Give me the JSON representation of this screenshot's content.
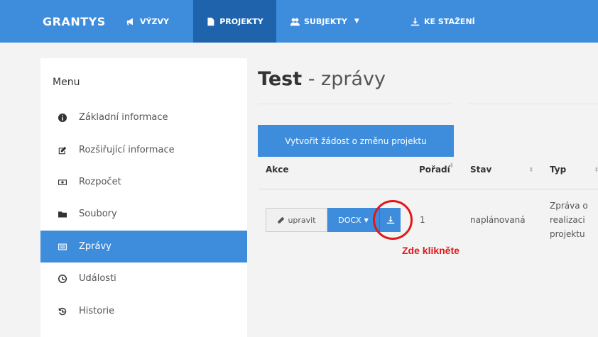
{
  "navbar": {
    "brand": "GRANTYS",
    "items": [
      {
        "label": "VÝZVY",
        "icon": "bullhorn-icon"
      },
      {
        "label": "PROJEKTY",
        "icon": "file-icon",
        "active": true
      },
      {
        "label": "SUBJEKTY",
        "icon": "users-icon",
        "dropdown": true
      },
      {
        "label": "KE STAŽENÍ",
        "icon": "download-icon"
      }
    ]
  },
  "sidebar": {
    "title": "Menu",
    "items": [
      {
        "label": "Základní informace",
        "icon": "info-icon"
      },
      {
        "label": "Rozšiřující informace",
        "icon": "edit-icon"
      },
      {
        "label": "Rozpočet",
        "icon": "money-icon"
      },
      {
        "label": "Soubory",
        "icon": "folder-icon"
      },
      {
        "label": "Zprávy",
        "icon": "list-icon",
        "active": true
      },
      {
        "label": "Události",
        "icon": "clock-icon"
      },
      {
        "label": "Historie",
        "icon": "history-icon"
      }
    ]
  },
  "main": {
    "title_bold": "Test",
    "title_rest": " - zprávy",
    "action_button": "Vytvořit žádost o změnu projektu",
    "table": {
      "columns": [
        "Akce",
        "Pořadí",
        "Stav",
        "Typ"
      ],
      "row": {
        "edit_label": "upravit",
        "docx_label": "DOCX",
        "order": "1",
        "status": "naplánovaná",
        "type_lines": [
          "Zpráva o",
          "realizaci",
          "projektu"
        ]
      }
    },
    "annotation": "Zde klikněte"
  },
  "colors": {
    "primary": "#3d8ddc",
    "nav_active": "#2063ad",
    "annotation_red": "#e01818"
  }
}
